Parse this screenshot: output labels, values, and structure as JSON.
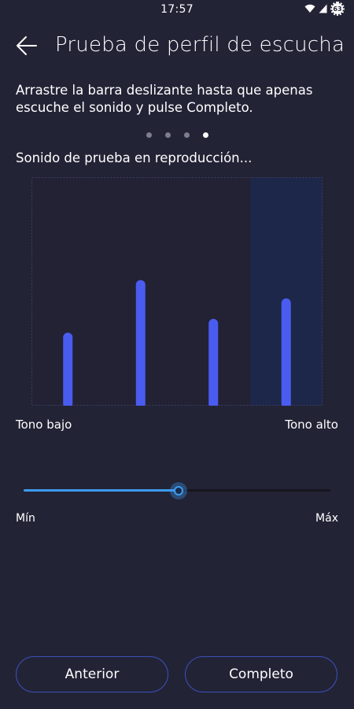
{
  "status_bar": {
    "time": "17:57",
    "battery_level": "63"
  },
  "header": {
    "title": "Prueba de perfil de escucha"
  },
  "instructions": "Arrastre la barra deslizante hasta que apenas escuche el sonido y pulse Completo.",
  "pager": {
    "total": 4,
    "active_index": 3
  },
  "test_status": "Sonido de prueba en reproducción...",
  "frequency_bars": {
    "levels": [
      0.32,
      0.55,
      0.38,
      0.47
    ],
    "highlighted_index": 3,
    "bar_color": "#4a5cf0",
    "highlight_color": "#1c2749"
  },
  "range_labels": {
    "low": "Tono bajo",
    "high": "Tono alto"
  },
  "slider": {
    "value": 0.505,
    "min_label": "Mín",
    "max_label": "Máx",
    "accent_color": "#3d9cf0"
  },
  "buttons": {
    "previous": "Anterior",
    "complete": "Completo"
  }
}
